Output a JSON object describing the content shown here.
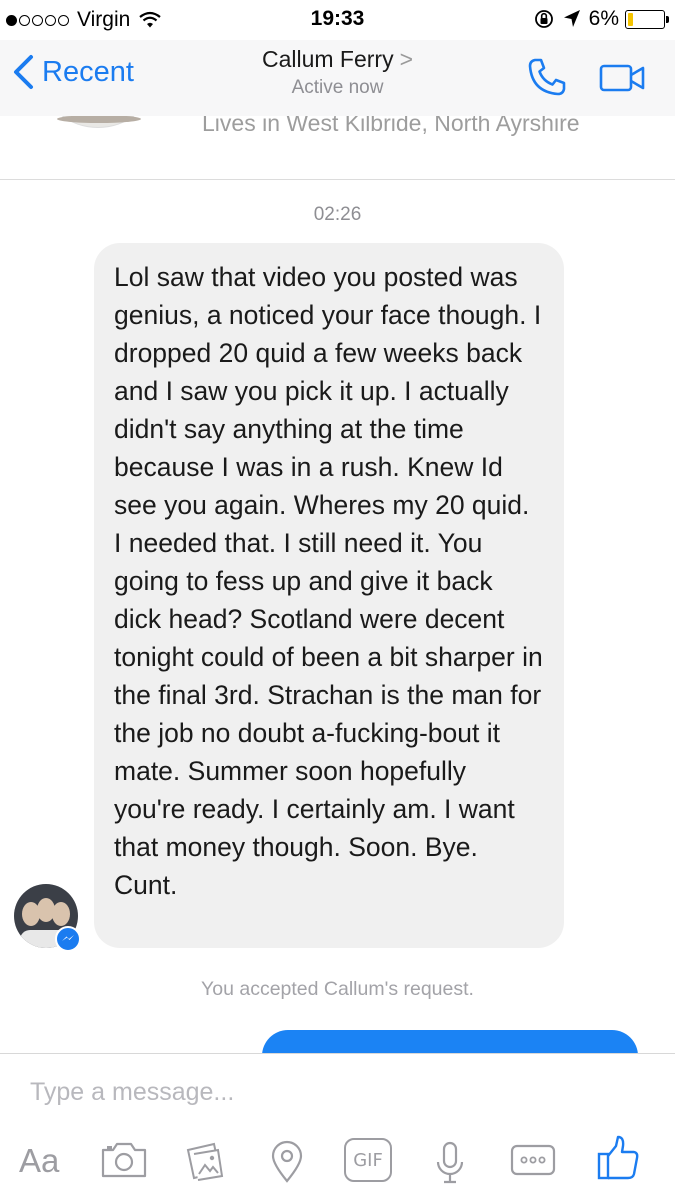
{
  "status_bar": {
    "carrier": "Virgin",
    "signal_bars": 1,
    "signal_total": 5,
    "time": "19:33",
    "battery_percent": "6%",
    "battery_level": 0.06
  },
  "nav": {
    "back_label": "Recent",
    "title": "Callum Ferry",
    "title_chevron": ">",
    "subtitle": "Active now",
    "accent_color": "#1b7cf0"
  },
  "profile": {
    "location": "Lives in West Kilbride, North Ayrshire"
  },
  "conversation": {
    "timestamp": "02:26",
    "incoming_message": "Lol saw that video you posted was genius, a noticed your face though. I dropped 20 quid a few weeks back and I saw you pick it up. I actually didn't say anything at the time because I was in a rush. Knew Id see you again. Wheres my 20 quid. I needed that. I still need it. You going to fess up and give it back dick head? Scotland were decent tonight could of been a bit sharper in the final 3rd. Strachan is the man for the job no doubt a-fucking-bout it mate. Summer soon hopefully you're ready. I certainly am. I want that money though. Soon. Bye. Cunt.",
    "system_note": "You accepted Callum's request.",
    "outgoing_bubble_color": "#1b83f4"
  },
  "composer": {
    "placeholder": "Type a message...",
    "aa_label": "Aa",
    "gif_label": "GIF",
    "tools": [
      "aa-icon",
      "camera-icon",
      "gallery-icon",
      "location-icon",
      "gif-icon",
      "microphone-icon",
      "more-icon",
      "like-icon"
    ]
  }
}
